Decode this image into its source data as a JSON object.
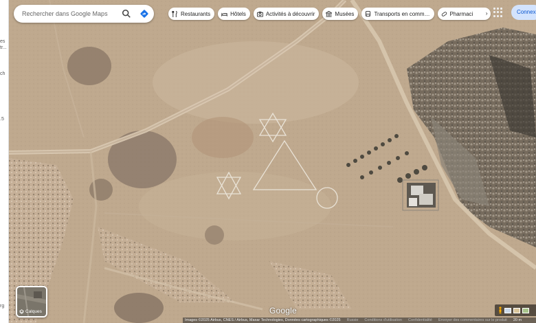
{
  "search": {
    "placeholder": "Rechercher dans Google Maps"
  },
  "chips": [
    {
      "label": "Restaurants",
      "icon": "fork-knife-icon"
    },
    {
      "label": "Hôtels",
      "icon": "bed-icon"
    },
    {
      "label": "Activités à découvrir",
      "icon": "camera-icon"
    },
    {
      "label": "Musées",
      "icon": "museum-icon"
    },
    {
      "label": "Transports en comm…",
      "icon": "bus-icon"
    },
    {
      "label": "Pharmaci",
      "icon": "pill-icon"
    }
  ],
  "login_label": "Connexion",
  "layers_label": "Calques",
  "map_logo": "Google",
  "attribution": {
    "imagery": "Images ©2025 Airbus, CNES / Airbus, Maxar Technologies, Données cartographiques ©2025",
    "country": "Russie",
    "terms": "Conditions d'utilisation",
    "privacy": "Confidentialité",
    "feedback": "Envoyer des commentaires sur le produit",
    "scale": "20 m"
  },
  "left_strip": [
    "es",
    "tr...",
    "ch",
    ".5",
    "rg"
  ],
  "colors": {
    "accent": "#1a73e8",
    "login_bg": "#d3e3fd",
    "terrain": "#bda88d"
  }
}
